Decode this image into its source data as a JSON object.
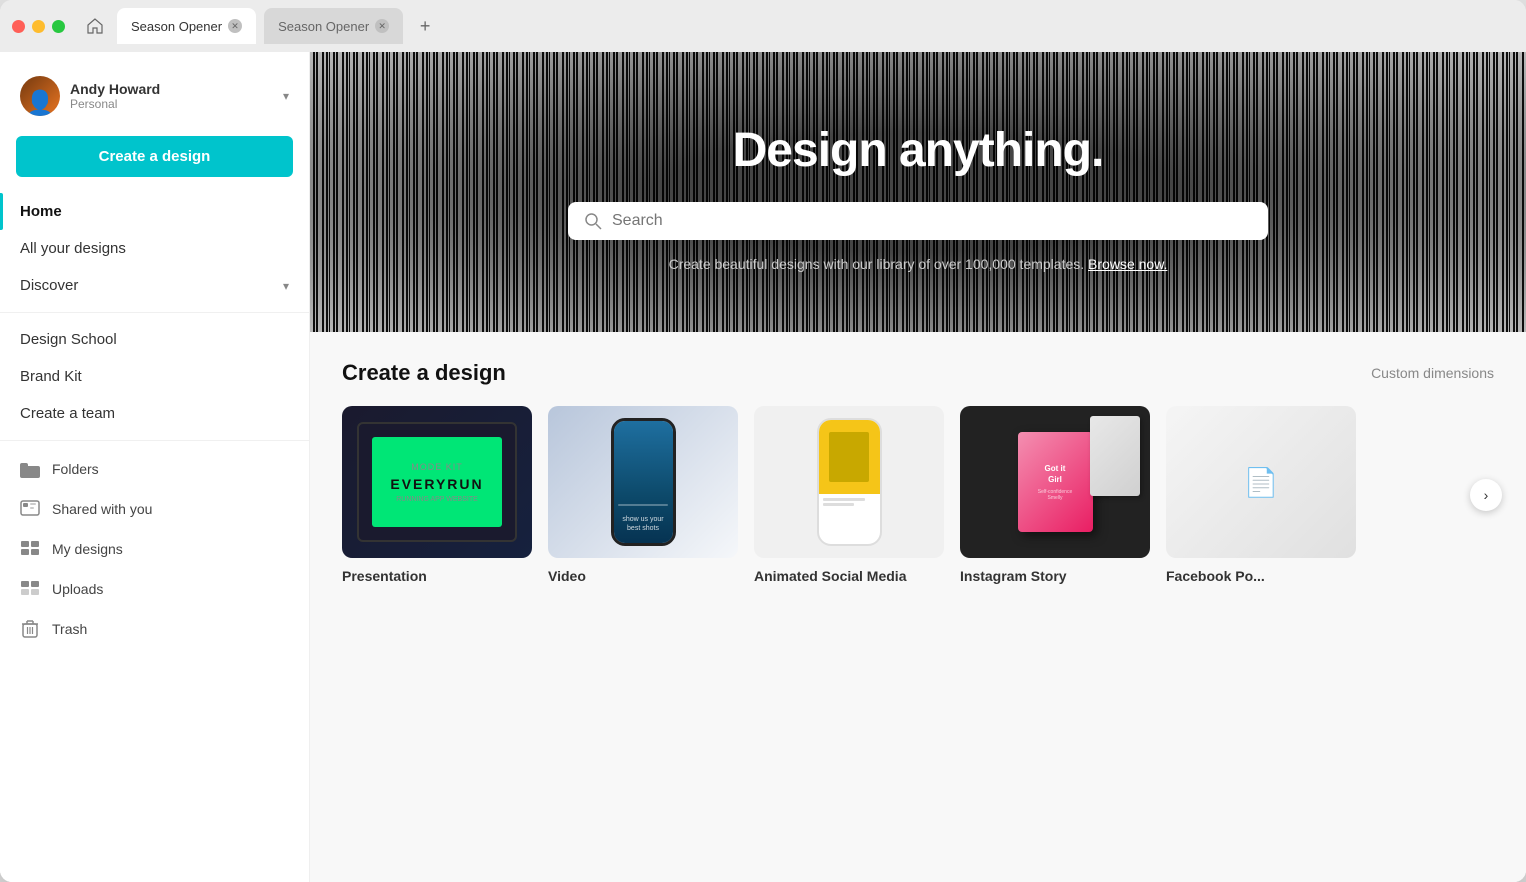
{
  "window": {
    "traffic_lights": [
      "red",
      "yellow",
      "green"
    ]
  },
  "tabs": [
    {
      "id": "home",
      "icon": "home",
      "label": null,
      "closable": false
    },
    {
      "id": "tab1",
      "label": "Season Opener",
      "active": true,
      "closable": true
    },
    {
      "id": "tab2",
      "label": "Season Opener",
      "active": false,
      "closable": true
    },
    {
      "id": "tab-add",
      "label": "+",
      "closable": false
    }
  ],
  "sidebar": {
    "user": {
      "name": "Andy Howard",
      "plan": "Personal"
    },
    "create_button": "Create a design",
    "nav_items": [
      {
        "id": "home",
        "label": "Home",
        "active": true
      },
      {
        "id": "all-designs",
        "label": "All your designs",
        "active": false
      },
      {
        "id": "discover",
        "label": "Discover",
        "active": false,
        "has_chevron": true
      }
    ],
    "secondary_nav": [
      {
        "id": "design-school",
        "label": "Design School"
      },
      {
        "id": "brand-kit",
        "label": "Brand Kit"
      },
      {
        "id": "create-team",
        "label": "Create a team"
      }
    ],
    "sections": [
      {
        "id": "folders",
        "label": "Folders",
        "icon": "folder"
      },
      {
        "id": "shared",
        "label": "Shared with you",
        "icon": "shared"
      },
      {
        "id": "my-designs",
        "label": "My designs",
        "icon": "my-designs"
      },
      {
        "id": "uploads",
        "label": "Uploads",
        "icon": "uploads"
      },
      {
        "id": "trash",
        "label": "Trash",
        "icon": "trash"
      }
    ]
  },
  "hero": {
    "title": "Design anything.",
    "search_placeholder": "Search",
    "subtitle": "Create beautiful designs with our library of over 100,000 templates.",
    "browse_link": "Browse now."
  },
  "create_section": {
    "title": "Create a design",
    "custom_dimensions": "Custom dimensions",
    "cards": [
      {
        "id": "presentation",
        "label": "Presentation",
        "screen_text": "EVERYRUN"
      },
      {
        "id": "video",
        "label": "Video"
      },
      {
        "id": "animated-social",
        "label": "Animated Social Media"
      },
      {
        "id": "instagram-story",
        "label": "Instagram Story"
      },
      {
        "id": "facebook-post",
        "label": "Facebook Po..."
      }
    ]
  }
}
